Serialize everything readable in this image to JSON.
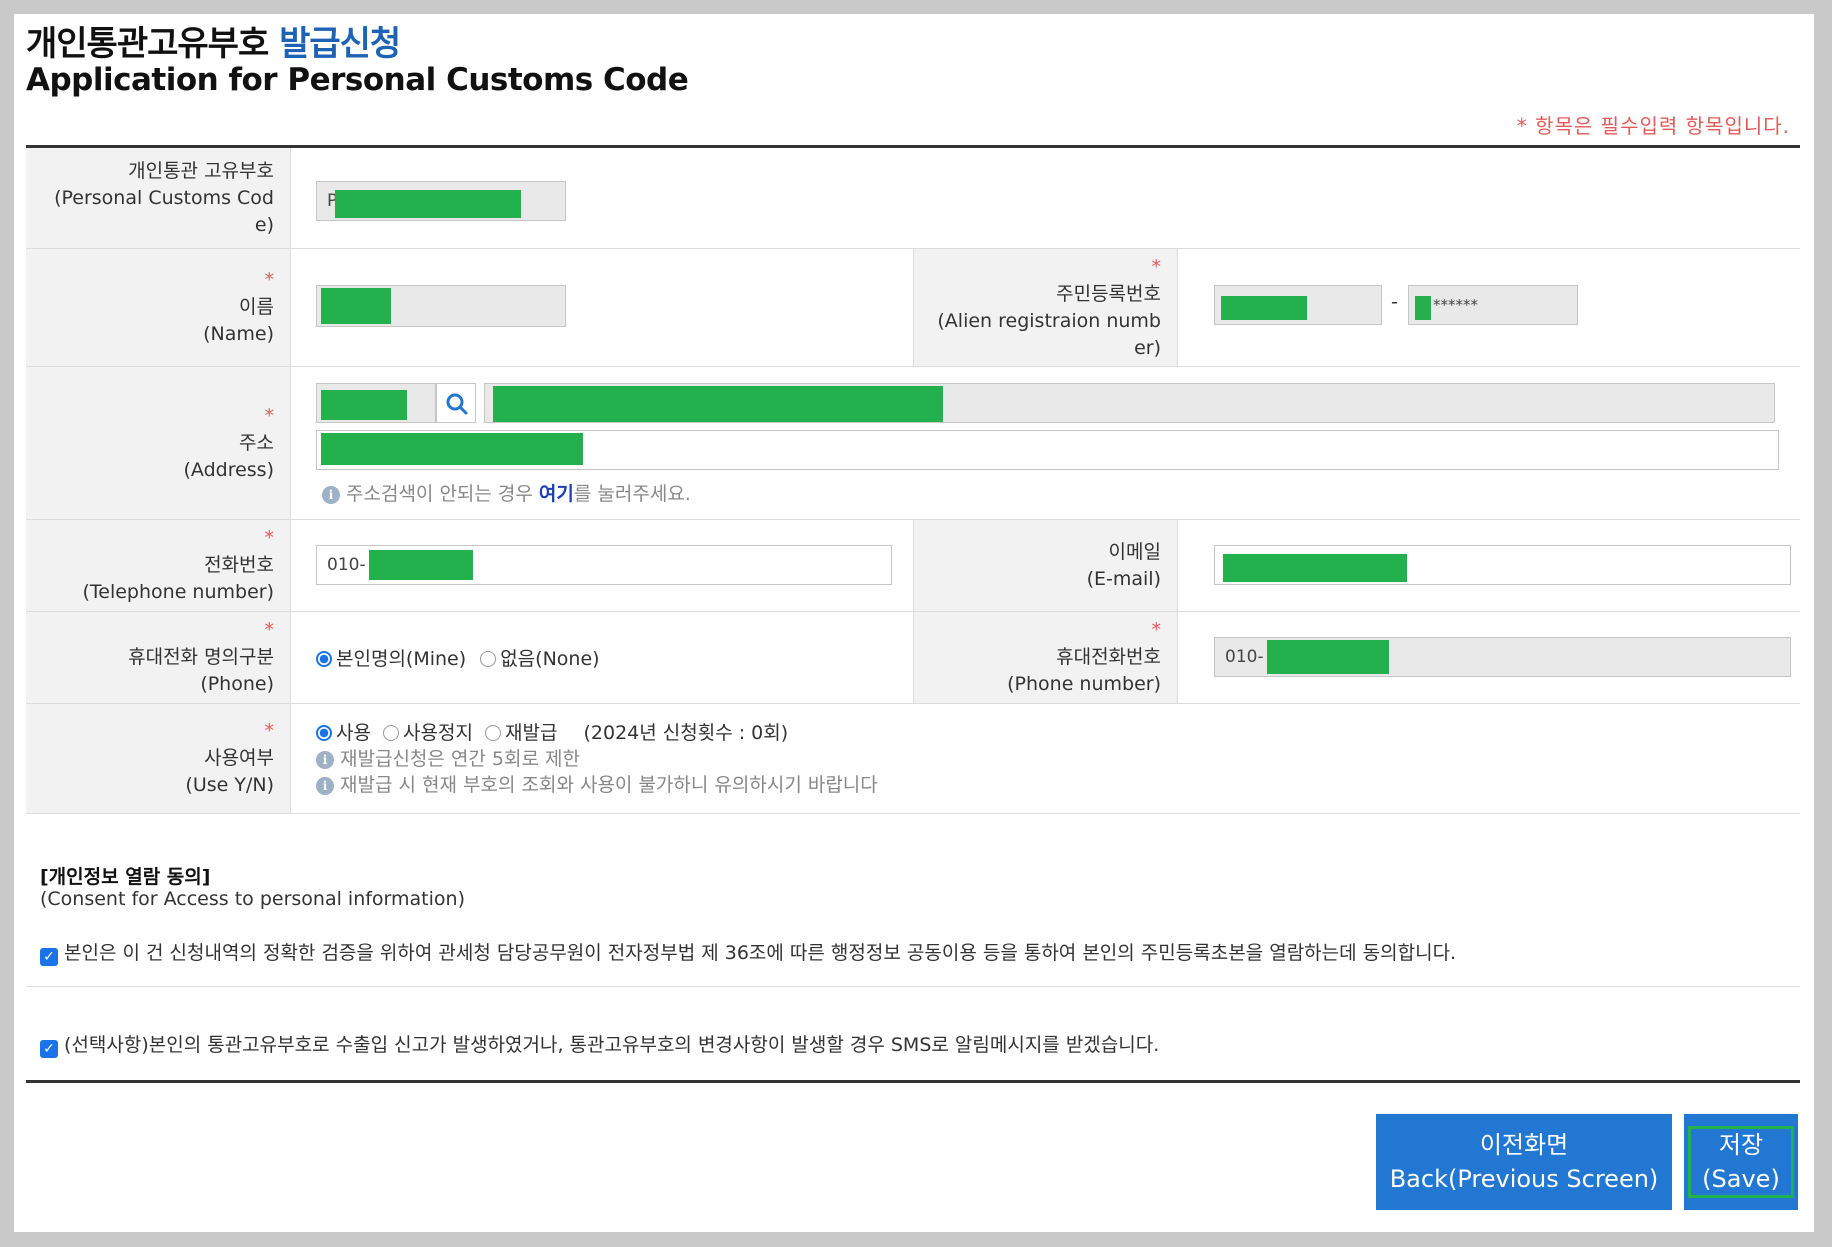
{
  "header": {
    "title_ko_main": "개인통관고유부호",
    "title_ko_accent": "발급신청",
    "title_en": "Application for Personal Customs Code",
    "required_note": "* 항목은 필수입력 항목입니다."
  },
  "fields": {
    "customs_code": {
      "label_ko": "개인통관 고유부호",
      "label_en": "(Personal Customs Cod",
      "label_en2": "e)",
      "value_prefix": "P"
    },
    "name": {
      "star": "*",
      "label_ko": "이름",
      "label_en": "(Name)"
    },
    "alien_reg": {
      "star": "*",
      "label_ko": "주민등록번호",
      "label_en": "(Alien registraion numb",
      "label_en2": "er)",
      "dash": "-",
      "second_mask": "******"
    },
    "address": {
      "star": "*",
      "label_ko": "주소",
      "label_en": "(Address)",
      "hint_before": "주소검색이 안되는 경우 ",
      "hint_link": "여기",
      "hint_after": "를 눌러주세요."
    },
    "telephone": {
      "star": "*",
      "label_ko": "전화번호",
      "label_en": "(Telephone number)",
      "value_prefix": "010-"
    },
    "email": {
      "label_ko": "이메일",
      "label_en": "(E-mail)"
    },
    "phone_owner": {
      "star": "*",
      "label_ko": "휴대전화 명의구분",
      "label_en": "(Phone)",
      "option_mine": "본인명의(Mine)",
      "option_none": "없음(None)"
    },
    "mobile": {
      "star": "*",
      "label_ko": "휴대전화번호",
      "label_en": "(Phone number)",
      "value_prefix": "010-"
    },
    "use_yn": {
      "star": "*",
      "label_ko": "사용여부",
      "label_en": "(Use Y/N)",
      "option_use": "사용",
      "option_stop": "사용정지",
      "option_reissue": "재발급",
      "count_note": "(2024년 신청횟수 : 0회)",
      "info1": "재발급신청은 연간 5회로 제한",
      "info2": "재발급 시 현재 부호의 조회와 사용이 불가하니 유의하시기 바랍니다"
    }
  },
  "consent": {
    "heading": "[개인정보 열람 동의]",
    "sub": "(Consent for Access to personal information)",
    "agree1": "본인은 이 건 신청내역의 정확한 검증을 위하여 관세청 담당공무원이 전자정부법 제 36조에 따른 행정정보 공동이용 등을 통하여 본인의 주민등록초본을 열람하는데 동의합니다.",
    "agree2": "(선택사항)본인의 통관고유부호로 수출입 신고가 발생하였거나, 통관고유부호의 변경사항이 발생할 경우 SMS로 알림메시지를 받겠습니다."
  },
  "buttons": {
    "back_ko": "이전화면",
    "back_en": "Back(Previous Screen)",
    "save_ko": "저장",
    "save_en": "(Save)"
  },
  "colors": {
    "accent": "#1e62b4",
    "button": "#2277d2",
    "required": "#e35a5a",
    "mask": "#22b14c"
  }
}
